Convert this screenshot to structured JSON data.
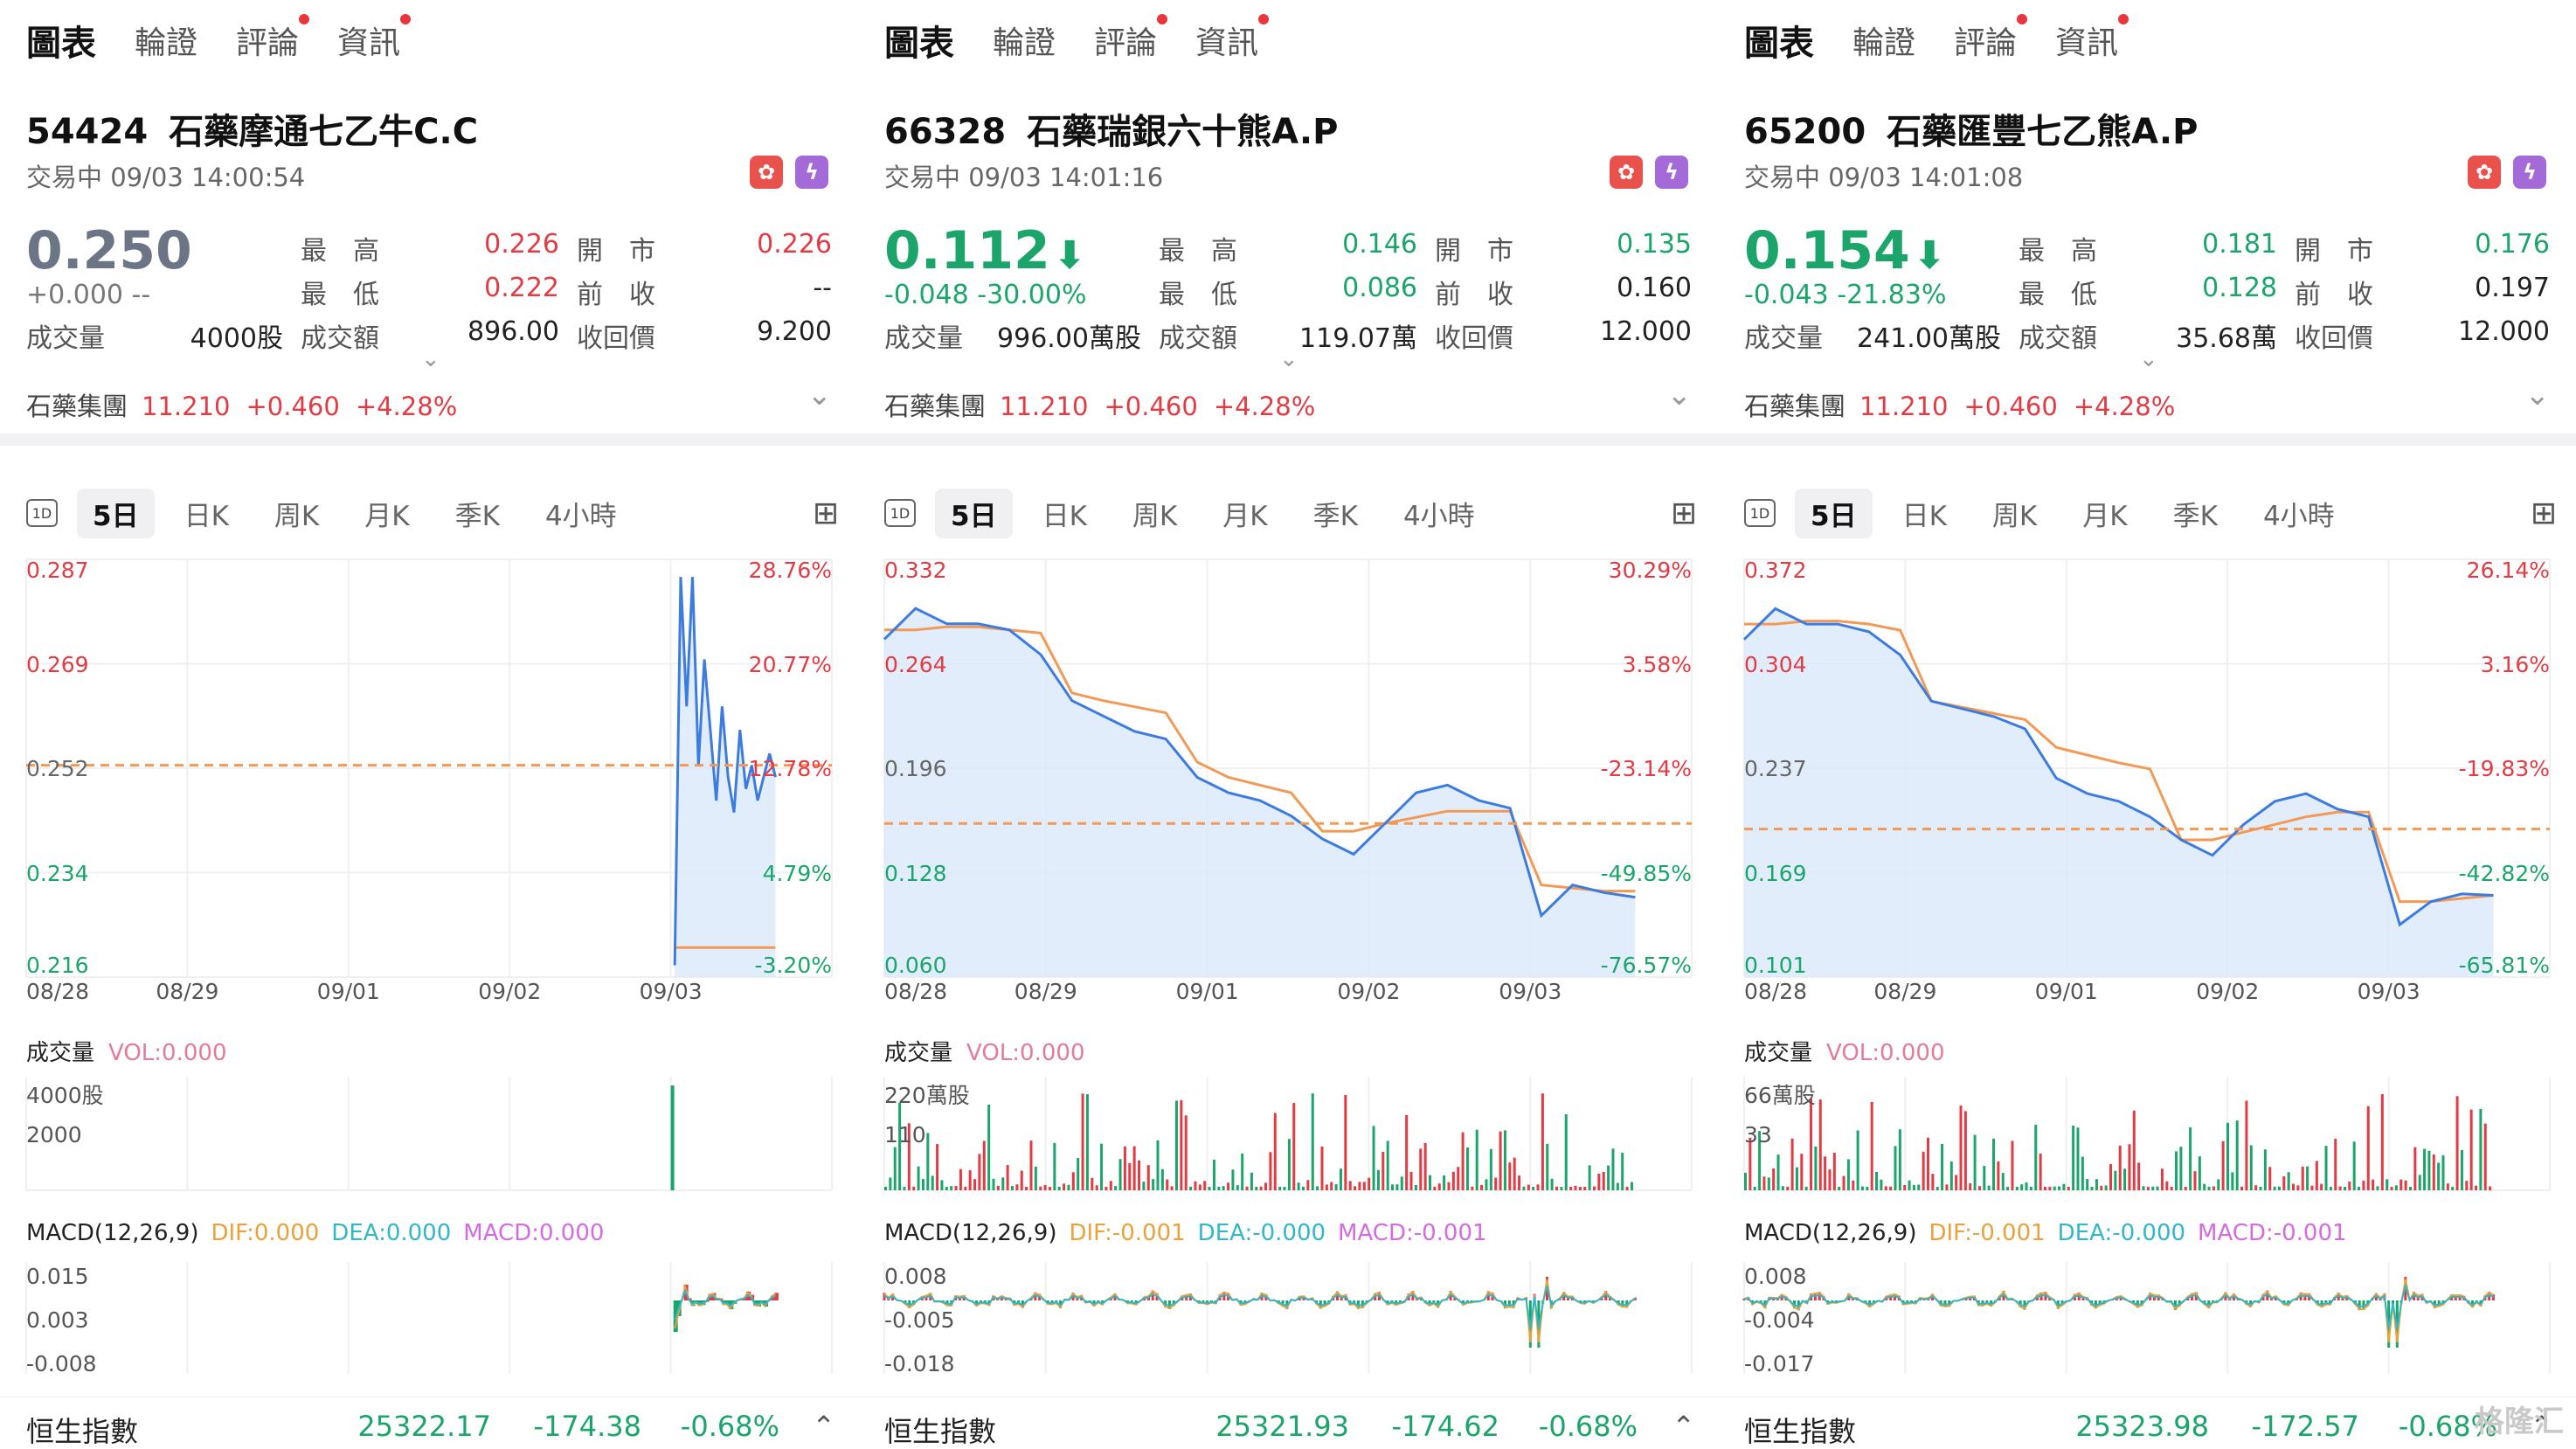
{
  "nav": {
    "tabs": [
      "圖表",
      "輪證",
      "評論",
      "資訊"
    ]
  },
  "colors": {
    "up": "#e23b44",
    "down": "#1ba56a",
    "line": "#3c7be0",
    "avg": "#f29a55",
    "fill": "#dbe8fb",
    "dif": "#e9a23b",
    "dea": "#31b7c9",
    "macd": "#d46be0"
  },
  "chart_tabs": [
    "5日",
    "日K",
    "周K",
    "月K",
    "季K",
    "4小時"
  ],
  "chart_tab_icon": "1D",
  "labels": {
    "high": "最　高",
    "low": "最　低",
    "open": "開　市",
    "prev": "前　收",
    "volume": "成交量",
    "turnover": "成交額",
    "callprice": "收回價",
    "vol_section": "成交量",
    "macd_section": "MACD(12,26,9)"
  },
  "bottom_index_name": "恒生指數",
  "watermark": "格隆汇",
  "panels": [
    {
      "code": "54424",
      "name": "石藥摩通七乙牛C.C",
      "status": "交易中 09/03 14:00:54",
      "price": "0.250",
      "arrow": "",
      "change": "+0.000 --",
      "trend": "flat",
      "high": "0.226",
      "low": "0.222",
      "open": "0.226",
      "prev": "--",
      "volume": "4000股",
      "turnover": "896.00",
      "callprice": "9.200",
      "group": {
        "name": "石藥集團",
        "price": "11.210",
        "chg": "+0.460",
        "pct": "+4.28%"
      },
      "y_left": [
        "0.287",
        "0.269",
        "0.252",
        "0.234",
        "0.216"
      ],
      "y_right": [
        "28.76%",
        "20.77%",
        "12.78%",
        "4.79%",
        "-3.20%"
      ],
      "x": [
        "08/28",
        "08/29",
        "09/01",
        "09/02",
        "09/03"
      ],
      "vol_label": "VOL:0.000",
      "vol_ticks": [
        "4000股",
        "2000"
      ],
      "macd_vals": {
        "dif": "DIF:0.000",
        "dea": "DEA:0.000",
        "macd": "MACD:0.000"
      },
      "macd_ticks": [
        "0.015",
        "0.003",
        "-0.008"
      ],
      "index": {
        "value": "25322.17",
        "chg": "-174.38",
        "pct": "-0.68%"
      },
      "chart_data": {
        "type": "line",
        "ylim": [
          0.216,
          0.287
        ],
        "prev_close": 0.252,
        "x": [
          "08/28",
          "08/29",
          "09/01",
          "09/02",
          "09/03"
        ],
        "series": [
          {
            "values": [
              0.218,
              0.284,
              0.262,
              0.284,
              0.252,
              0.27,
              0.258,
              0.246,
              0.262,
              0.25,
              0.244,
              0.258,
              0.248,
              0.252,
              0.246,
              0.25,
              0.254,
              0.25
            ]
          },
          {
            "values": [
              0.221,
              0.221,
              0.221,
              0.221,
              0.221,
              0.221,
              0.221,
              0.221,
              0.221,
              0.221,
              0.221,
              0.221,
              0.221,
              0.221,
              0.221,
              0.221,
              0.221,
              0.221
            ]
          }
        ]
      }
    },
    {
      "code": "66328",
      "name": "石藥瑞銀六十熊A.P",
      "status": "交易中 09/03 14:01:16",
      "price": "0.112",
      "arrow": "⬇",
      "change": "-0.048 -30.00%",
      "trend": "down",
      "high": "0.146",
      "low": "0.086",
      "open": "0.135",
      "prev": "0.160",
      "volume": "996.00萬股",
      "turnover": "119.07萬",
      "callprice": "12.000",
      "group": {
        "name": "石藥集團",
        "price": "11.210",
        "chg": "+0.460",
        "pct": "+4.28%"
      },
      "y_left": [
        "0.332",
        "0.264",
        "0.196",
        "0.128",
        "0.060"
      ],
      "y_right": [
        "30.29%",
        "3.58%",
        "-23.14%",
        "-49.85%",
        "-76.57%"
      ],
      "x": [
        "08/28",
        "08/29",
        "09/01",
        "09/02",
        "09/03"
      ],
      "vol_label": "VOL:0.000",
      "vol_ticks": [
        "220萬股",
        "110"
      ],
      "macd_vals": {
        "dif": "DIF:-0.001",
        "dea": "DEA:-0.000",
        "macd": "MACD:-0.001"
      },
      "macd_ticks": [
        "0.008",
        "-0.005",
        "-0.018"
      ],
      "index": {
        "value": "25321.93",
        "chg": "-174.62",
        "pct": "-0.68%"
      },
      "chart_data": {
        "type": "line",
        "ylim": [
          0.06,
          0.332
        ],
        "prev_close": 0.16,
        "x": [
          "08/28",
          "08/29",
          "09/01",
          "09/02",
          "09/03"
        ],
        "series": [
          {
            "values": [
              0.28,
              0.3,
              0.29,
              0.29,
              0.286,
              0.27,
              0.24,
              0.23,
              0.22,
              0.215,
              0.19,
              0.18,
              0.175,
              0.165,
              0.15,
              0.14,
              0.16,
              0.18,
              0.185,
              0.175,
              0.17,
              0.1,
              0.12,
              0.115,
              0.112
            ]
          },
          {
            "values": [
              0.286,
              0.286,
              0.288,
              0.288,
              0.286,
              0.284,
              0.245,
              0.24,
              0.236,
              0.232,
              0.2,
              0.19,
              0.185,
              0.18,
              0.155,
              0.155,
              0.16,
              0.164,
              0.168,
              0.168,
              0.168,
              0.12,
              0.118,
              0.116,
              0.116
            ]
          }
        ]
      }
    },
    {
      "code": "65200",
      "name": "石藥匯豐七乙熊A.P",
      "status": "交易中 09/03 14:01:08",
      "price": "0.154",
      "arrow": "⬇",
      "change": "-0.043 -21.83%",
      "trend": "down",
      "high": "0.181",
      "low": "0.128",
      "open": "0.176",
      "prev": "0.197",
      "volume": "241.00萬股",
      "turnover": "35.68萬",
      "callprice": "12.000",
      "group": {
        "name": "石藥集團",
        "price": "11.210",
        "chg": "+0.460",
        "pct": "+4.28%"
      },
      "y_left": [
        "0.372",
        "0.304",
        "0.237",
        "0.169",
        "0.101"
      ],
      "y_right": [
        "26.14%",
        "3.16%",
        "-19.83%",
        "-42.82%",
        "-65.81%"
      ],
      "x": [
        "08/28",
        "08/29",
        "09/01",
        "09/02",
        "09/03"
      ],
      "vol_label": "VOL:0.000",
      "vol_ticks": [
        "66萬股",
        "33"
      ],
      "macd_vals": {
        "dif": "DIF:-0.001",
        "dea": "DEA:-0.000",
        "macd": "MACD:-0.001"
      },
      "macd_ticks": [
        "0.008",
        "-0.004",
        "-0.017"
      ],
      "index": {
        "value": "25323.98",
        "chg": "-172.57",
        "pct": "-0.68%"
      },
      "chart_data": {
        "type": "line",
        "ylim": [
          0.101,
          0.372
        ],
        "prev_close": 0.197,
        "x": [
          "08/28",
          "08/29",
          "09/01",
          "09/02",
          "09/03"
        ],
        "series": [
          {
            "values": [
              0.32,
              0.34,
              0.33,
              0.33,
              0.325,
              0.31,
              0.28,
              0.275,
              0.27,
              0.262,
              0.23,
              0.22,
              0.215,
              0.205,
              0.19,
              0.18,
              0.2,
              0.215,
              0.22,
              0.21,
              0.205,
              0.135,
              0.15,
              0.155,
              0.154
            ]
          },
          {
            "values": [
              0.33,
              0.33,
              0.332,
              0.332,
              0.33,
              0.326,
              0.28,
              0.276,
              0.272,
              0.268,
              0.25,
              0.245,
              0.24,
              0.236,
              0.19,
              0.19,
              0.195,
              0.2,
              0.205,
              0.208,
              0.208,
              0.15,
              0.15,
              0.152,
              0.154
            ]
          }
        ]
      }
    }
  ]
}
